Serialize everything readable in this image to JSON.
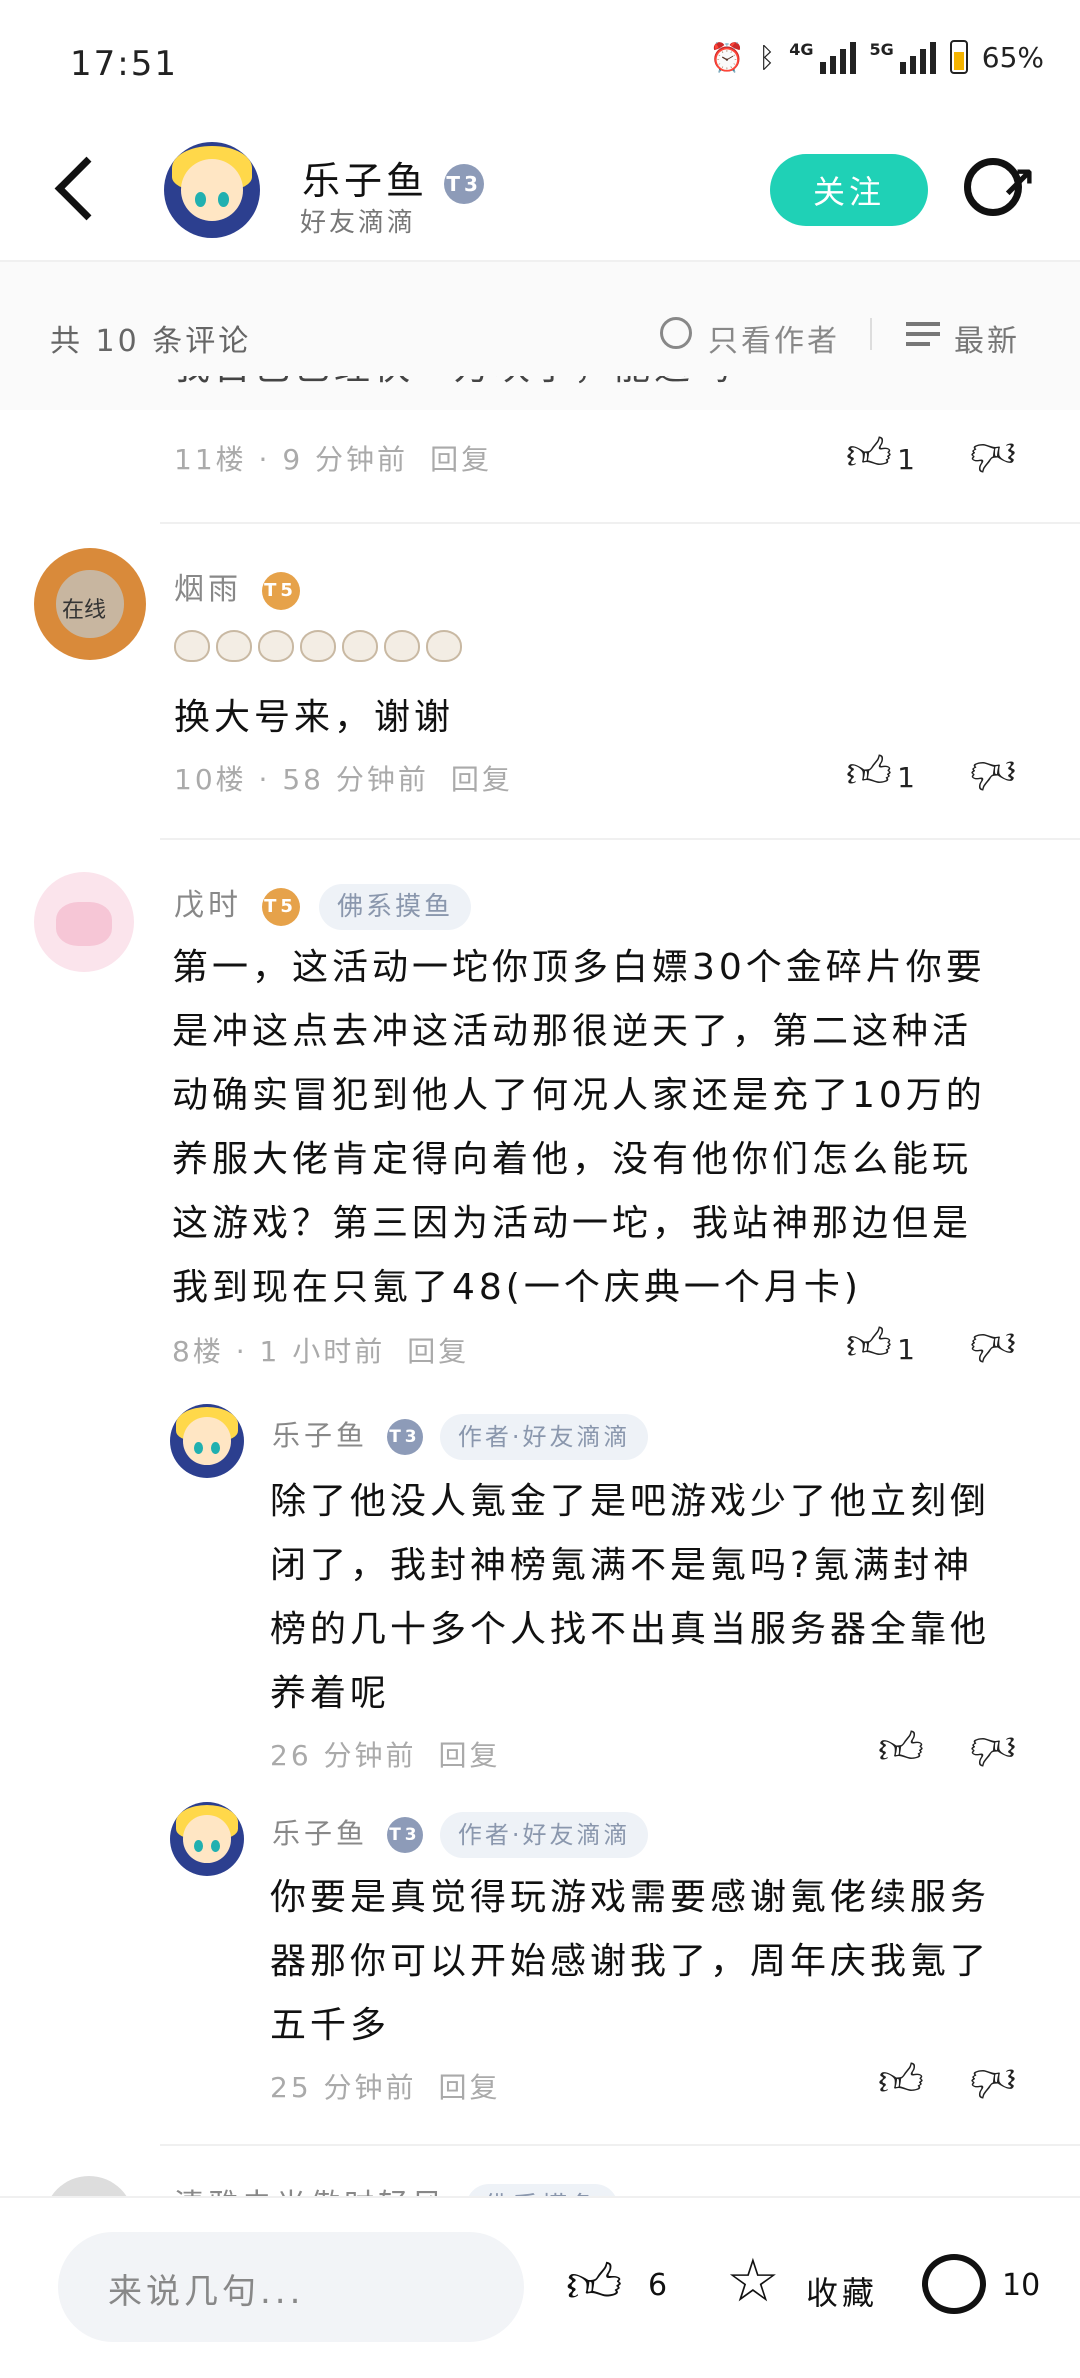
{
  "status_bar": {
    "time": "17:51",
    "network_1": "4G",
    "network_2": "5G",
    "battery": "65%"
  },
  "header": {
    "author_name": "乐子鱼",
    "author_level": "3",
    "author_sub": "好友滴滴",
    "follow_label": "关注"
  },
  "comments_bar": {
    "count_label": "共 10 条评论",
    "only_author_label": "只看作者",
    "sort_label": "最新"
  },
  "comments": [
    {
      "partial_text": "我自己已经快一万块了，能退吗",
      "floor": "11楼",
      "time": "9 分钟前",
      "reply": "回复",
      "likes": "1"
    },
    {
      "name": "烟雨",
      "level": "5",
      "avatar_badge": "在线",
      "text": "换大号来，谢谢",
      "floor": "10楼",
      "time": "58 分钟前",
      "reply": "回复",
      "likes": "1"
    },
    {
      "name": "戊时",
      "level": "5",
      "tag": "佛系摸鱼",
      "text_lines": [
        "第一，这活动一坨你顶多白嫖30个金碎片你要",
        "是冲这点去冲这活动那很逆天了，第二这种活",
        "动确实冒犯到他人了何况人家还是充了10万的",
        "养服大佬肯定得向着他，没有他你们怎么能玩",
        "这游戏？第三因为活动一坨，我站神那边但是",
        "我到现在只氪了48(一个庆典一个月卡)"
      ],
      "floor": "8楼",
      "time": "1 小时前",
      "reply": "回复",
      "likes": "1",
      "replies": [
        {
          "name": "乐子鱼",
          "level": "3",
          "tag": "作者·好友滴滴",
          "text_lines": [
            "除了他没人氪金了是吧游戏少了他立刻倒",
            "闭了，我封神榜氪满不是氪吗?氪满封神",
            "榜的几十多个人找不出真当服务器全靠他",
            "养着呢"
          ],
          "time": "26 分钟前",
          "reply": "回复"
        },
        {
          "name": "乐子鱼",
          "level": "3",
          "tag": "作者·好友滴滴",
          "text_lines": [
            "你要是真觉得玩游戏需要感谢氪佬续服务",
            "器那你可以开始感谢我了，周年庆我氪了",
            "五千多"
          ],
          "time": "25 分钟前",
          "reply": "回复"
        }
      ]
    },
    {
      "partial_name": "清雅虫光傲时轻风",
      "partial_tag": "佛系摸鱼"
    }
  ],
  "bottom_bar": {
    "input_placeholder": "来说几句...",
    "like_count": "6",
    "collect_label": "收藏",
    "comment_count": "10"
  },
  "colors": {
    "accent": "#1fd1b6",
    "level_gold": "#e6a24a",
    "level_blue": "#8d9bb8"
  }
}
